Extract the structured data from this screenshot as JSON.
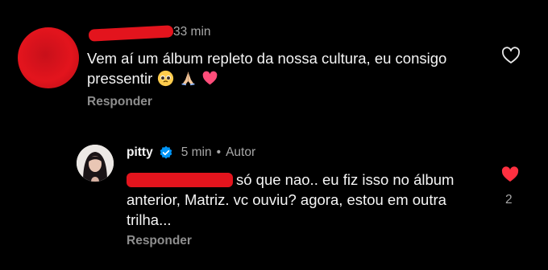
{
  "comment1": {
    "time": "33 min",
    "text": "Vem aí um álbum repleto da nossa cultura, eu consigo pressentir",
    "emojis": [
      "pleading-face",
      "folded-hands",
      "pink-heart"
    ],
    "reply_label": "Responder",
    "liked": false
  },
  "comment2": {
    "username": "pitty",
    "verified": true,
    "time": "5 min",
    "separator": "•",
    "author_label": "Autor",
    "text": "só que nao.. eu fiz isso no álbum anterior, Matriz.  vc ouviu? agora, estou em outra trilha...",
    "reply_label": "Responder",
    "liked": true,
    "like_count": "2"
  },
  "colors": {
    "background": "#000000",
    "text": "#f5f5f5",
    "muted": "#a8a8a8",
    "like_red": "#ff3040",
    "verified_blue": "#0095f6",
    "redaction_red": "#e3141d"
  }
}
